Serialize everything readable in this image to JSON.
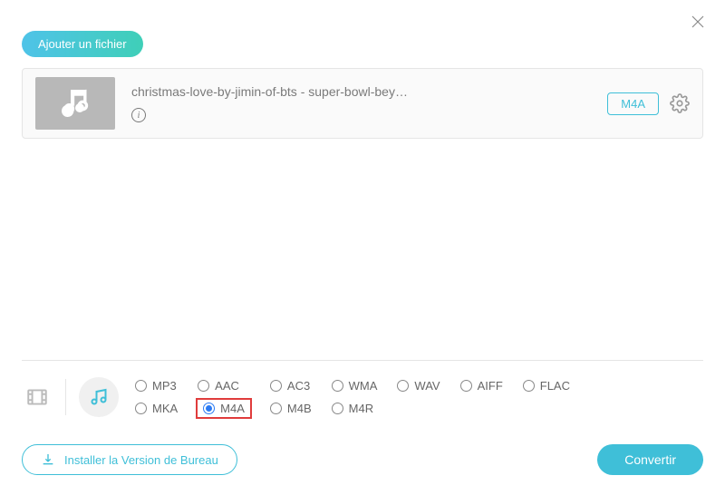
{
  "header": {
    "add_file_label": "Ajouter un fichier"
  },
  "file": {
    "name": "christmas-love-by-jimin-of-bts - super-bowl-bey…",
    "format_badge": "M4A"
  },
  "formats": {
    "row1": [
      "MP3",
      "AAC",
      "AC3",
      "WMA",
      "WAV",
      "AIFF",
      "FLAC"
    ],
    "row2": [
      "MKA",
      "M4A",
      "M4B",
      "M4R"
    ],
    "selected": "M4A"
  },
  "footer": {
    "install_label": "Installer la Version de Bureau",
    "convert_label": "Convertir"
  }
}
